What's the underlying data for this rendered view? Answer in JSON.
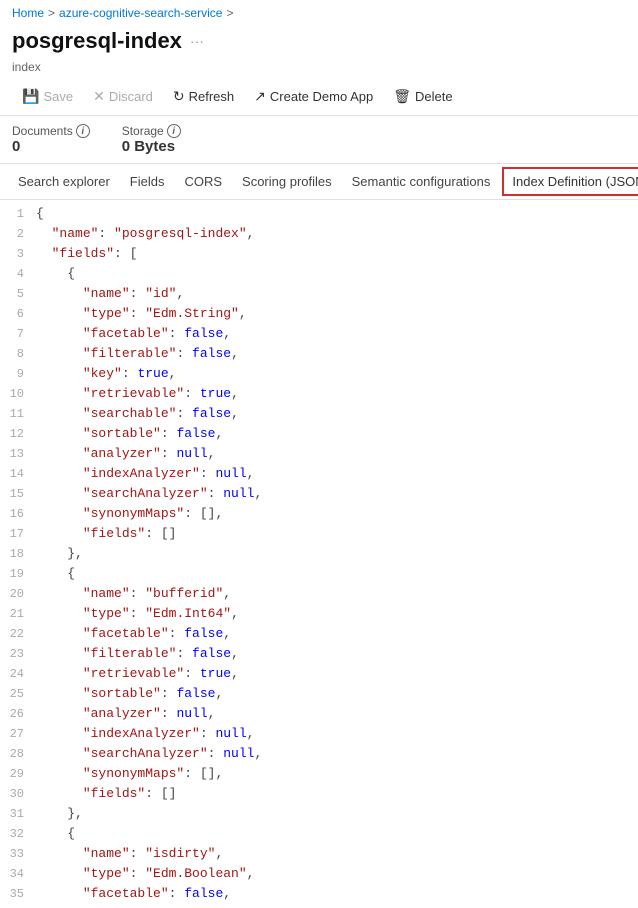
{
  "breadcrumb": {
    "home": "Home",
    "separator1": ">",
    "service": "azure-cognitive-search-service",
    "separator2": ">"
  },
  "header": {
    "title": "posgresql-index",
    "ellipsis": "···",
    "subtitle": "index"
  },
  "toolbar": {
    "save_label": "Save",
    "discard_label": "Discard",
    "refresh_label": "Refresh",
    "create_demo_label": "Create Demo App",
    "delete_label": "Delete"
  },
  "stats": {
    "documents_label": "Documents",
    "documents_value": "0",
    "storage_label": "Storage",
    "storage_value": "0 Bytes"
  },
  "tabs": [
    {
      "id": "search-explorer",
      "label": "Search explorer"
    },
    {
      "id": "fields",
      "label": "Fields"
    },
    {
      "id": "cors",
      "label": "CORS"
    },
    {
      "id": "scoring-profiles",
      "label": "Scoring profiles"
    },
    {
      "id": "semantic-configurations",
      "label": "Semantic configurations"
    },
    {
      "id": "index-definition",
      "label": "Index Definition (JSON)",
      "active": true,
      "highlighted": true
    }
  ],
  "code": {
    "lines": [
      {
        "num": 1,
        "content": "{"
      },
      {
        "num": 2,
        "content": "  \"name\": \"posgresql-index\","
      },
      {
        "num": 3,
        "content": "  \"fields\": ["
      },
      {
        "num": 4,
        "content": "    {"
      },
      {
        "num": 5,
        "content": "      \"name\": \"id\","
      },
      {
        "num": 6,
        "content": "      \"type\": \"Edm.String\","
      },
      {
        "num": 7,
        "content": "      \"facetable\": false,"
      },
      {
        "num": 8,
        "content": "      \"filterable\": false,"
      },
      {
        "num": 9,
        "content": "      \"key\": true,"
      },
      {
        "num": 10,
        "content": "      \"retrievable\": true,"
      },
      {
        "num": 11,
        "content": "      \"searchable\": false,"
      },
      {
        "num": 12,
        "content": "      \"sortable\": false,"
      },
      {
        "num": 13,
        "content": "      \"analyzer\": null,"
      },
      {
        "num": 14,
        "content": "      \"indexAnalyzer\": null,"
      },
      {
        "num": 15,
        "content": "      \"searchAnalyzer\": null,"
      },
      {
        "num": 16,
        "content": "      \"synonymMaps\": [],"
      },
      {
        "num": 17,
        "content": "      \"fields\": []"
      },
      {
        "num": 18,
        "content": "    },"
      },
      {
        "num": 19,
        "content": "    {"
      },
      {
        "num": 20,
        "content": "      \"name\": \"bufferid\","
      },
      {
        "num": 21,
        "content": "      \"type\": \"Edm.Int64\","
      },
      {
        "num": 22,
        "content": "      \"facetable\": false,"
      },
      {
        "num": 23,
        "content": "      \"filterable\": false,"
      },
      {
        "num": 24,
        "content": "      \"retrievable\": true,"
      },
      {
        "num": 25,
        "content": "      \"sortable\": false,"
      },
      {
        "num": 26,
        "content": "      \"analyzer\": null,"
      },
      {
        "num": 27,
        "content": "      \"indexAnalyzer\": null,"
      },
      {
        "num": 28,
        "content": "      \"searchAnalyzer\": null,"
      },
      {
        "num": 29,
        "content": "      \"synonymMaps\": [],"
      },
      {
        "num": 30,
        "content": "      \"fields\": []"
      },
      {
        "num": 31,
        "content": "    },"
      },
      {
        "num": 32,
        "content": "    {"
      },
      {
        "num": 33,
        "content": "      \"name\": \"isdirty\","
      },
      {
        "num": 34,
        "content": "      \"type\": \"Edm.Boolean\","
      },
      {
        "num": 35,
        "content": "      \"facetable\": false,"
      }
    ]
  }
}
